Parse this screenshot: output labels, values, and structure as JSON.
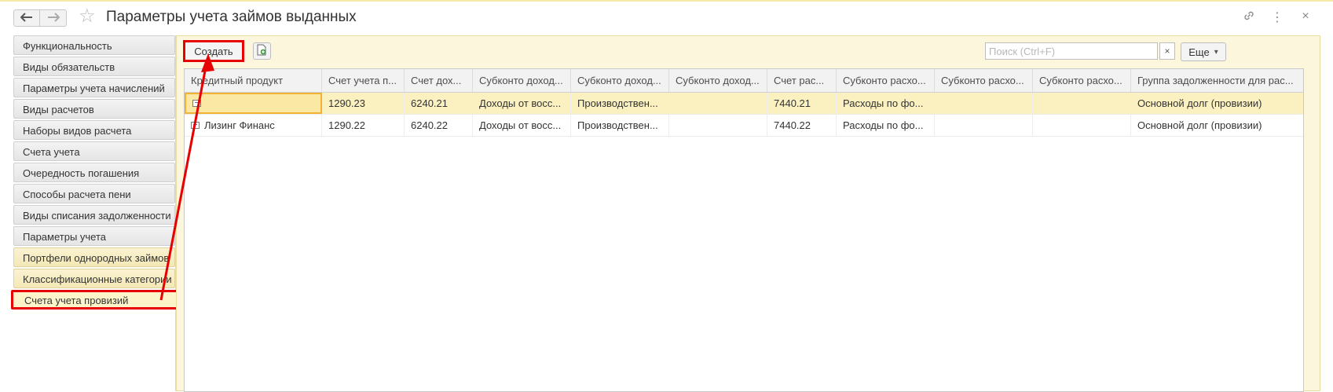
{
  "window": {
    "title": "Параметры учета займов выданных",
    "back_icon": "arrow-left-icon",
    "forward_icon": "arrow-right-icon",
    "favorite_icon": "star-icon",
    "link_icon": "link-icon",
    "menu_icon": "more-vert-icon",
    "close_icon": "close-icon"
  },
  "sidebar": {
    "items": [
      {
        "label": "Функциональность"
      },
      {
        "label": "Виды обязательств"
      },
      {
        "label": "Параметры учета начислений"
      },
      {
        "label": "Виды расчетов"
      },
      {
        "label": "Наборы видов расчета"
      },
      {
        "label": "Счета учета"
      },
      {
        "label": "Очередность погашения"
      },
      {
        "label": "Способы расчета пени"
      },
      {
        "label": "Виды списания задолженности"
      },
      {
        "label": "Параметры учета"
      },
      {
        "label": "Портфели однородных займов"
      },
      {
        "label": "Классификационные категории"
      },
      {
        "label": "Счета учета провизий"
      }
    ],
    "active_index": 12
  },
  "toolbar": {
    "create_label": "Создать",
    "copy_icon": "document-add-icon",
    "search_placeholder": "Поиск (Ctrl+F)",
    "search_value": "",
    "clear_label": "×",
    "more_label": "Еще",
    "more_chevron": "▾"
  },
  "table": {
    "columns": [
      "Кредитный продукт",
      "Счет учета п...",
      "Счет дох...",
      "Субконто доход...",
      "Субконто доход...",
      "Субконто доход...",
      "Счет рас...",
      "Субконто расхо...",
      "Субконто расхо...",
      "Субконто расхо...",
      "Группа задолженности для рас..."
    ],
    "rows": [
      {
        "cells": [
          "",
          "1290.23",
          "6240.21",
          "Доходы от восс...",
          "Производствен...",
          "",
          "7440.21",
          "Расходы по фо...",
          "",
          "",
          "Основной долг (провизии)"
        ],
        "selected": true
      },
      {
        "cells": [
          "Лизинг Финанс",
          "1290.22",
          "6240.22",
          "Доходы от восс...",
          "Производствен...",
          "",
          "7440.22",
          "Расходы по фо...",
          "",
          "",
          "Основной долг (провизии)"
        ],
        "selected": false
      }
    ]
  },
  "colors": {
    "highlight": "#e60000",
    "panel_bg": "#fbf6dc",
    "selected_row": "#fbf0c0"
  }
}
